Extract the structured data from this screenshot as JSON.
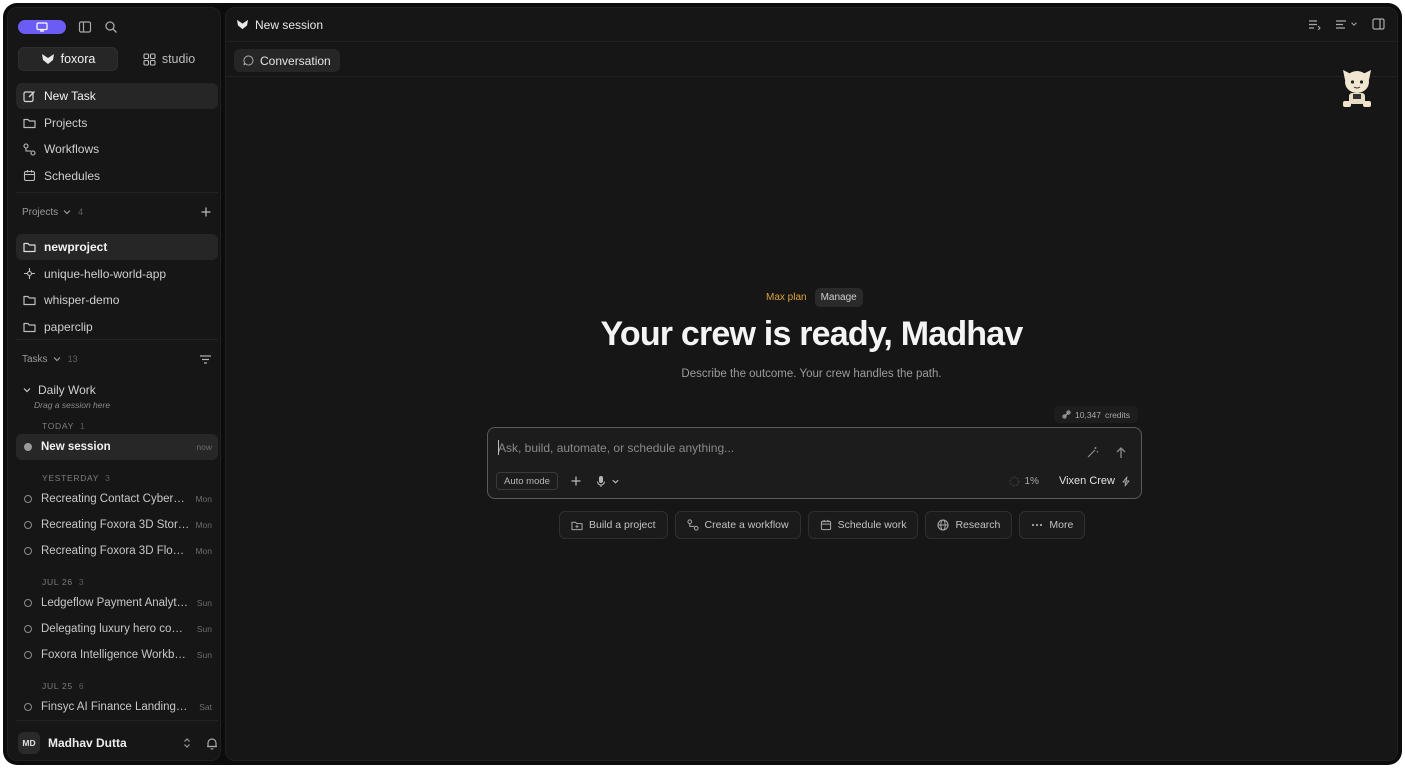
{
  "sidebar": {
    "brand_tabs": [
      {
        "label": "foxora",
        "active": true
      },
      {
        "label": "studio",
        "active": false
      }
    ],
    "nav": [
      {
        "label": "New Task",
        "icon": "edit-icon"
      },
      {
        "label": "Projects",
        "icon": "folder-icon"
      },
      {
        "label": "Workflows",
        "icon": "workflow-icon"
      },
      {
        "label": "Schedules",
        "icon": "calendar-icon"
      }
    ],
    "projects_header": {
      "label": "Projects",
      "count": "4"
    },
    "projects": [
      {
        "label": "newproject",
        "icon": "folder-icon"
      },
      {
        "label": "unique-hello-world-app",
        "icon": "component-icon"
      },
      {
        "label": "whisper-demo",
        "icon": "folder-icon"
      },
      {
        "label": "paperclip",
        "icon": "folder-icon"
      }
    ],
    "tasks_header": {
      "label": "Tasks",
      "count": "13"
    },
    "daily_work": {
      "label": "Daily Work",
      "hint": "Drag a session here"
    },
    "groups": [
      {
        "day": "TODAY",
        "count": "1",
        "items": [
          {
            "title": "New session",
            "when": "now"
          }
        ]
      },
      {
        "day": "YESTERDAY",
        "count": "3",
        "items": [
          {
            "title": "Recreating Contact Cyber…",
            "when": "Mon"
          },
          {
            "title": "Recreating Foxora 3D Stor…",
            "when": "Mon"
          },
          {
            "title": "Recreating Foxora 3D Flow…",
            "when": "Mon"
          }
        ]
      },
      {
        "day": "JUL 26",
        "count": "3",
        "items": [
          {
            "title": "Ledgeflow Payment Analyt…",
            "when": "Sun"
          },
          {
            "title": "Delegating luxury hero co…",
            "when": "Sun"
          },
          {
            "title": "Foxora Intelligence Workb…",
            "when": "Sun"
          }
        ]
      },
      {
        "day": "JUL 25",
        "count": "6",
        "items": [
          {
            "title": "Finsyc AI Finance Landing …",
            "when": "Sat"
          }
        ]
      }
    ],
    "user": {
      "initials": "MD",
      "name": "Madhav Dutta"
    }
  },
  "main": {
    "title": "New session",
    "tab": "Conversation",
    "plan": {
      "name": "Max plan",
      "manage": "Manage"
    },
    "hero": "Your crew is ready, Madhav",
    "subtitle": "Describe the outcome. Your crew handles the path.",
    "credits": {
      "amount": "10,347",
      "label": "credits"
    },
    "composer": {
      "placeholder": "Ask, build, automate, or schedule anything...",
      "mode": "Auto mode",
      "usage": "1%",
      "crew": "Vixen Crew"
    },
    "actions": [
      {
        "label": "Build a project",
        "icon": "folder-plus-icon"
      },
      {
        "label": "Create a workflow",
        "icon": "workflow-icon"
      },
      {
        "label": "Schedule work",
        "icon": "calendar-icon"
      },
      {
        "label": "Research",
        "icon": "globe-icon"
      },
      {
        "label": "More",
        "icon": "more-icon"
      }
    ]
  },
  "colors": {
    "accent": "#6b5cf6",
    "plan": "#d9a23b",
    "background": "#0c0c0c",
    "panel": "#161616"
  }
}
